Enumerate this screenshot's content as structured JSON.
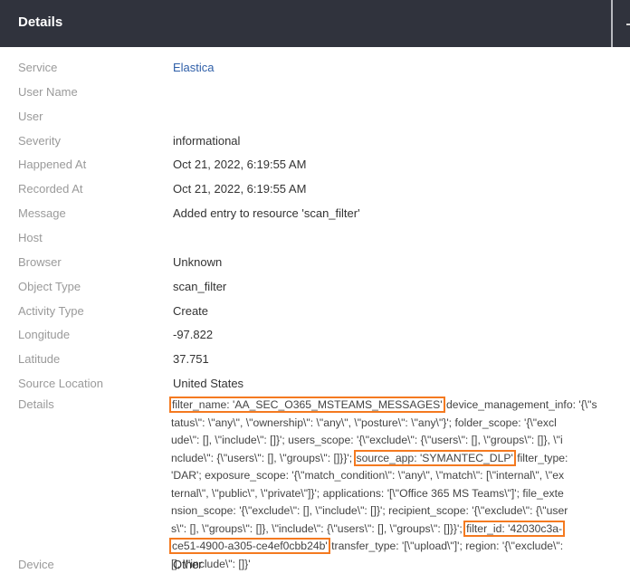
{
  "header": {
    "title": "Details"
  },
  "fields": [
    {
      "label": "Service",
      "value": "Elastica",
      "link": true
    },
    {
      "label": "User Name",
      "value": ""
    },
    {
      "label": "User",
      "value": ""
    },
    {
      "label": "Severity",
      "value": "informational"
    },
    {
      "label": "Happened At",
      "value": "Oct 21, 2022, 6:19:55 AM"
    },
    {
      "label": "Recorded At",
      "value": "Oct 21, 2022, 6:19:55 AM"
    },
    {
      "label": "Message",
      "value": "Added entry to resource 'scan_filter'"
    },
    {
      "label": "Host",
      "value": ""
    },
    {
      "label": "Browser",
      "value": "Unknown"
    },
    {
      "label": "Object Type",
      "value": "scan_filter"
    },
    {
      "label": "Activity Type",
      "value": "Create"
    },
    {
      "label": "Longitude",
      "value": "-97.822"
    },
    {
      "label": "Latitude",
      "value": "37.751"
    },
    {
      "label": "Source Location",
      "value": "United States"
    }
  ],
  "details": {
    "label": "Details",
    "lines": [
      [
        {
          "t": "filter_name: 'AA_SEC_O365_MSTEAMS_MESSAGES'",
          "hl": true
        },
        {
          "t": " device_management_info: '{\\\"s"
        }
      ],
      [
        {
          "t": "tatus\\\": \\\"any\\\", \\\"ownership\\\": \\\"any\\\", \\\"posture\\\": \\\"any\\\"}'; folder_scope: '{\\\"excl"
        }
      ],
      [
        {
          "t": "ude\\\": [], \\\"include\\\": []}'; users_scope: '{\\\"exclude\\\": {\\\"users\\\": [], \\\"groups\\\": []}, \\\"i"
        }
      ],
      [
        {
          "t": "nclude\\\": {\\\"users\\\": [], \\\"groups\\\": []}}'; "
        },
        {
          "t": "source_app: 'SYMANTEC_DLP'",
          "hl": true
        },
        {
          "t": " filter_type:"
        }
      ],
      [
        {
          "t": "'DAR'; exposure_scope: '{\\\"match_condition\\\": \\\"any\\\", \\\"match\\\": [\\\"internal\\\", \\\"ex"
        }
      ],
      [
        {
          "t": "ternal\\\", \\\"public\\\", \\\"private\\\"]}'; applications: '[\\\"Office 365 MS Teams\\\"]'; file_exte"
        }
      ],
      [
        {
          "t": "nsion_scope: '{\\\"exclude\\\": [], \\\"include\\\": []}'; recipient_scope: '{\\\"exclude\\\": {\\\"user"
        }
      ],
      [
        {
          "t": "s\\\": [], \\\"groups\\\": []}, \\\"include\\\": {\\\"users\\\": [], \\\"groups\\\": []}}'; "
        },
        {
          "t": "filter_id: '42030c3a-",
          "hl": true
        }
      ],
      [
        {
          "t": "ce51-4900-a305-ce4ef0cbb24b'",
          "hl": true
        },
        {
          "t": " transfer_type: '[\\\"upload\\\"]'; region: '{\\\"exclude\\\":"
        }
      ],
      [
        {
          "t": "[], \\\"include\\\": []}'"
        }
      ]
    ]
  },
  "device": {
    "label": "Device",
    "value": "Other"
  },
  "colors": {
    "header_bg": "#30333d",
    "highlight": "#f47a20",
    "link": "#2f5fa8"
  }
}
